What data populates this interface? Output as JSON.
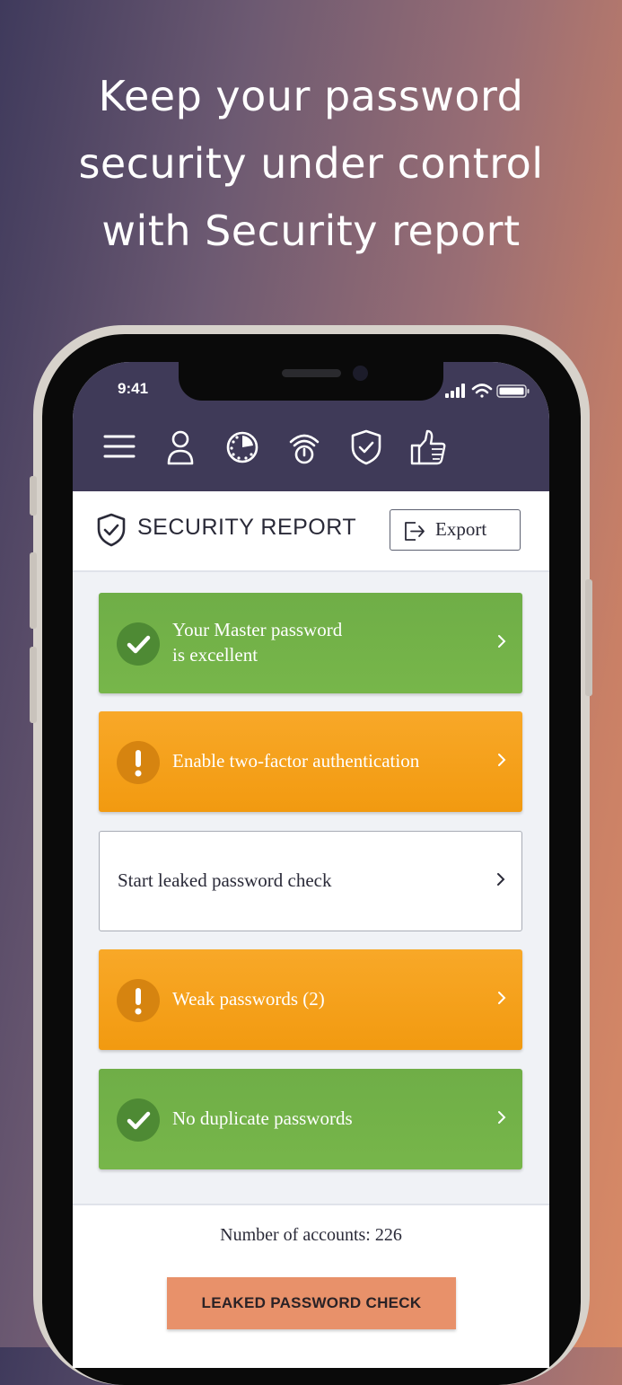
{
  "headline": {
    "line1": "Keep your password",
    "line2": "security under control",
    "line3": "with Security report"
  },
  "status_bar": {
    "time": "9:41"
  },
  "nav_icons": [
    "menu-icon",
    "profile-icon",
    "dashboard-icon",
    "fingerprint-icon",
    "shield-icon",
    "thumbs-up-icon"
  ],
  "header": {
    "title": "SECURITY REPORT",
    "export_label": "Export"
  },
  "cards": [
    {
      "line1": "Your Master password",
      "line2": "is excellent",
      "status": "ok"
    },
    {
      "line1": "Enable two-factor authentication",
      "status": "warning"
    },
    {
      "line1": "Start leaked password check",
      "status": "neutral"
    },
    {
      "line1": "Weak passwords (2)",
      "status": "warning"
    },
    {
      "line1": "No duplicate passwords",
      "status": "ok"
    }
  ],
  "footer": {
    "accounts_text": "Number of accounts: 226",
    "leak_button": "LEAKED PASSWORD CHECK"
  },
  "colors": {
    "topbar": "#3f3a58",
    "ok": "#72b24a",
    "warning": "#f5a11c",
    "accent_button": "#e8916a"
  }
}
